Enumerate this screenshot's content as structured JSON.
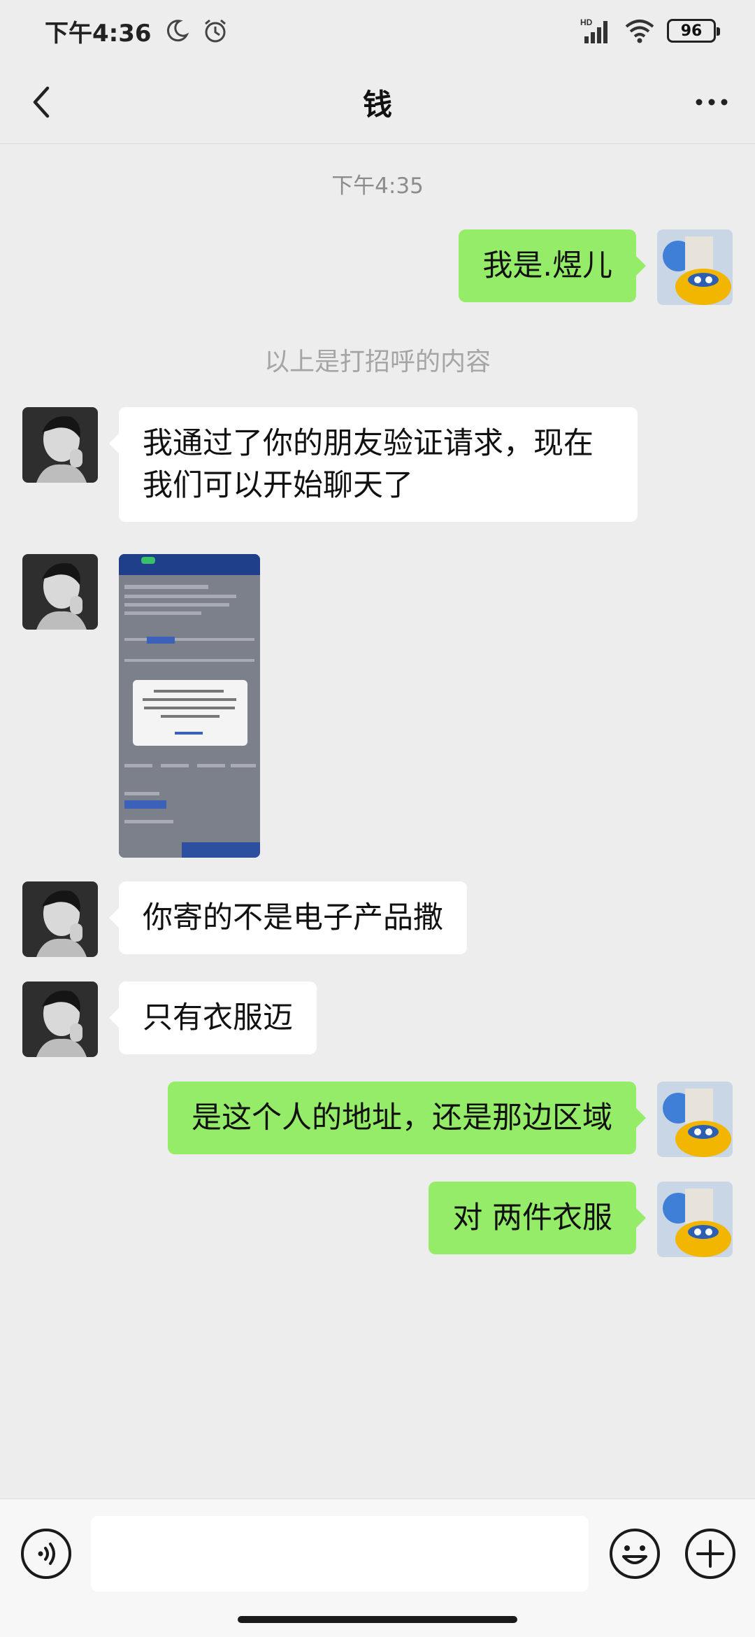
{
  "status_bar": {
    "time": "下午4:36",
    "network": "HD",
    "battery": "96"
  },
  "nav": {
    "title": "钱"
  },
  "chat": {
    "time_separator": "下午4:35",
    "system_note": "以上是打招呼的内容",
    "messages": [
      {
        "side": "out",
        "text": "我是.煜儿"
      },
      {
        "side": "in",
        "text": "我通过了你的朋友验证请求，现在我们可以开始聊天了"
      },
      {
        "side": "in",
        "type": "image"
      },
      {
        "side": "in",
        "text": "你寄的不是电子产品撒"
      },
      {
        "side": "in",
        "text": "只有衣服迈"
      },
      {
        "side": "out",
        "text": "是这个人的地址，还是那边区域"
      },
      {
        "side": "out",
        "text": "对 两件衣服"
      }
    ]
  },
  "input_bar": {
    "icons": [
      "voice-icon",
      "emoji-icon",
      "plus-icon"
    ]
  },
  "colors": {
    "background": "#ededed",
    "outgoing_bubble": "#95ec69",
    "incoming_bubble": "#ffffff"
  }
}
